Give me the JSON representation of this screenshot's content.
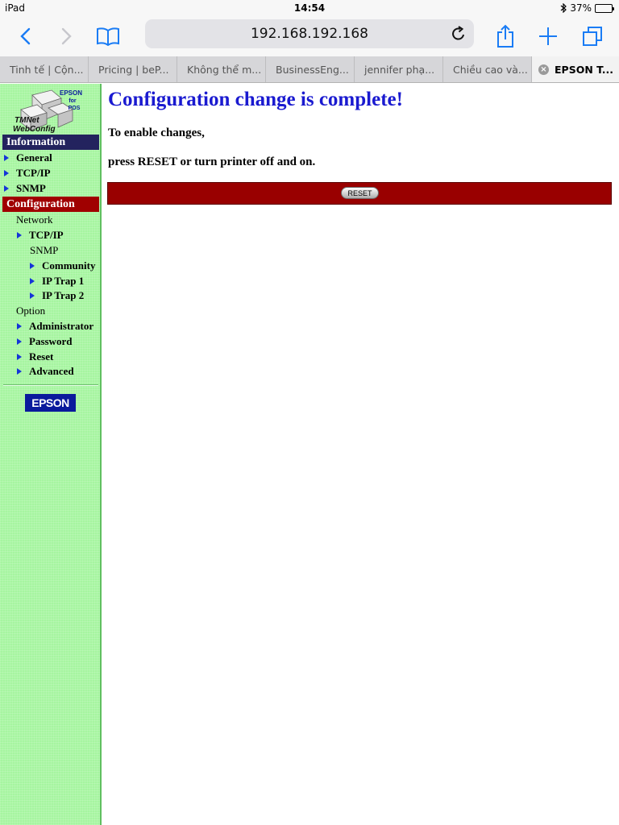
{
  "status_bar": {
    "device": "iPad",
    "time": "14:54",
    "battery": "37%",
    "battery_level": 0.37
  },
  "toolbar": {
    "url": "192.168.192.168"
  },
  "tabs": [
    {
      "label": "Tinh tế | Cộn..."
    },
    {
      "label": "Pricing | beP..."
    },
    {
      "label": "Không thể m..."
    },
    {
      "label": "BusinessEng..."
    },
    {
      "label": "jennifer phạ..."
    },
    {
      "label": "Chiều cao và..."
    },
    {
      "label": "EPSON T...",
      "active": true
    }
  ],
  "sidebar": {
    "logo": {
      "brand": "EPSON",
      "for": "for",
      "pos": "POS",
      "product_line1": "TMNet",
      "product_line2": "WebConfig"
    },
    "information_header": "Information",
    "information_items": {
      "general": "General",
      "tcpip": "TCP/IP",
      "snmp": "SNMP"
    },
    "configuration_header": "Configuration",
    "network_label": "Network",
    "config_tcpip": "TCP/IP",
    "snmp_label": "SNMP",
    "community": "Community",
    "ip_trap_1": "IP Trap 1",
    "ip_trap_2": "IP Trap 2",
    "option_label": "Option",
    "administrator": "Administrator",
    "password": "Password",
    "reset": "Reset",
    "advanced": "Advanced",
    "epson_badge": "EPSON"
  },
  "main": {
    "title": "Configuration change is complete!",
    "message_line1": "To enable changes,",
    "message_line2": "press RESET or turn printer off and on.",
    "reset_button": "RESET"
  },
  "colors": {
    "sidebar_bg": "#a6f5a0",
    "info_header": "#23235e",
    "config_header": "#a00000",
    "title_blue": "#1a1ad0",
    "reset_bar": "#990000",
    "ios_blue": "#1a7cf5"
  }
}
